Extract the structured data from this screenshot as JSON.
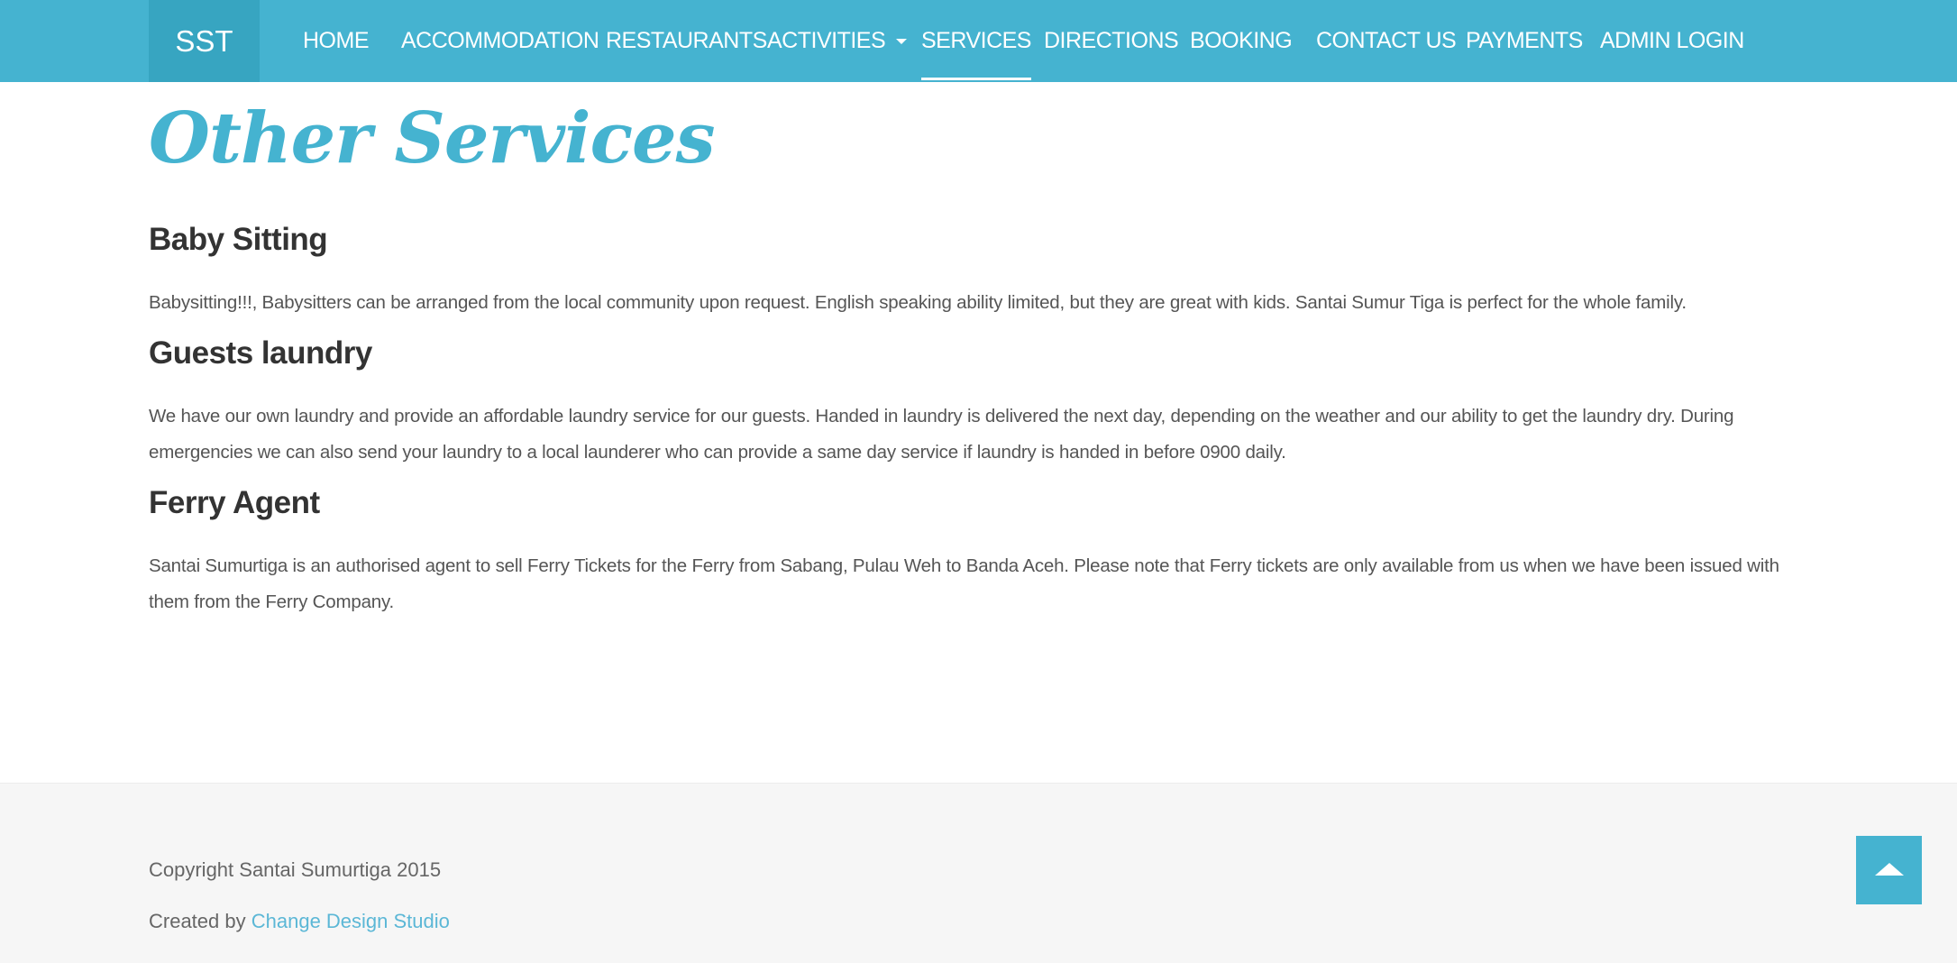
{
  "nav": {
    "brand": "SST",
    "items": [
      {
        "label": "HOME"
      },
      {
        "label": "ACCOMMODATION"
      },
      {
        "label": "RESTAURANTS"
      },
      {
        "label": "ACTIVITIES"
      },
      {
        "label": "SERVICES"
      },
      {
        "label": "DIRECTIONS"
      },
      {
        "label": "BOOKING"
      },
      {
        "label": "CONTACT US"
      },
      {
        "label": "PAYMENTS"
      },
      {
        "label": "ADMIN LOGIN"
      }
    ],
    "active_item": "SERVICES"
  },
  "main": {
    "title": "Other Services",
    "sections": [
      {
        "heading": "Baby Sitting",
        "text": "Babysitting!!!, Babysitters can be arranged from the local community upon request. English speaking ability limited, but they are great with kids. Santai Sumur Tiga is perfect for the whole family."
      },
      {
        "heading": "Guests laundry",
        "text": "We have our own laundry and provide an affordable laundry service for our guests. Handed in laundry is delivered the next day, depending on the weather and our ability to get the laundry dry. During emergencies we can also send your laundry to a local launderer who can provide a same day service if laundry is handed in before 0900 daily."
      },
      {
        "heading": "Ferry Agent",
        "text": "Santai Sumurtiga is an authorised agent to sell Ferry Tickets for the Ferry from Sabang, Pulau Weh to Banda Aceh. Please note that Ferry tickets are only available from us when we have been issued with them from the Ferry Company."
      }
    ]
  },
  "footer": {
    "copyright": "Copyright Santai Sumurtiga 2015",
    "credit_prefix": "Created by ",
    "credit_link": "Change Design Studio"
  },
  "icons": {
    "dropdown": "chevron-down-icon",
    "back_to_top": "arrow-up-icon"
  },
  "colors": {
    "accent": "#45b3d0",
    "brand_bg": "#37a5c1",
    "footer_bg": "#f6f6f6",
    "link": "#5bb7d6"
  }
}
